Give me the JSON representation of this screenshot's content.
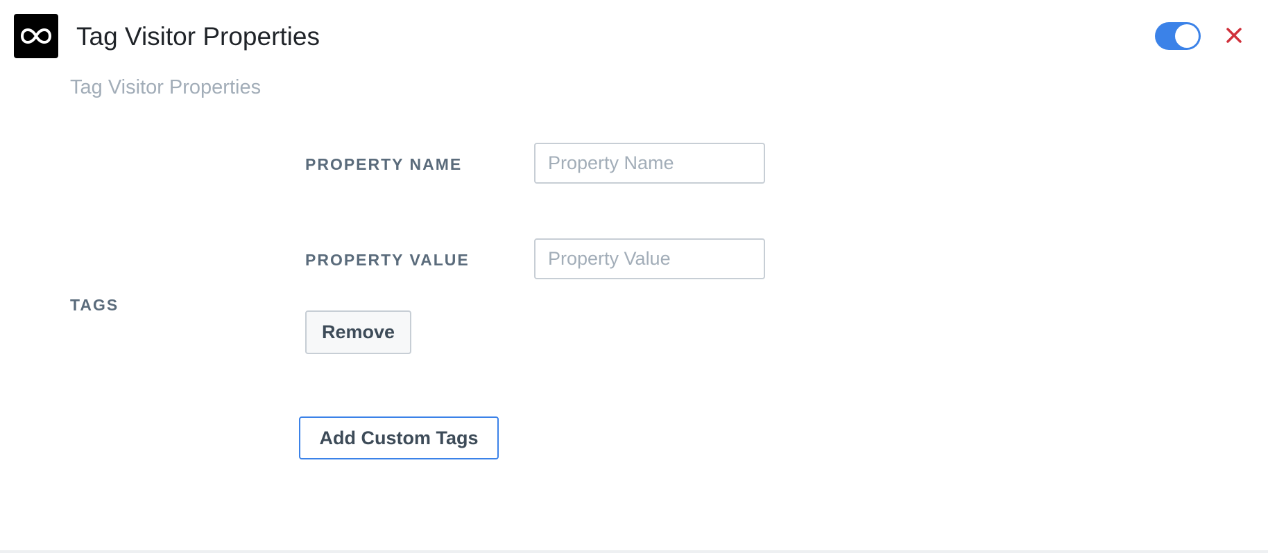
{
  "header": {
    "title": "Tag Visitor Properties",
    "subtitle": "Tag Visitor Properties",
    "logo_icon": "infinity-icon",
    "toggle_state": "on",
    "close_icon": "close-icon"
  },
  "tags": {
    "section_label": "TAGS",
    "fields": {
      "property_name_label": "PROPERTY NAME",
      "property_name_placeholder": "Property Name",
      "property_name_value": "",
      "property_value_label": "PROPERTY VALUE",
      "property_value_placeholder": "Property Value",
      "property_value_value": ""
    },
    "remove_label": "Remove",
    "add_label": "Add Custom Tags"
  },
  "colors": {
    "accent": "#3b82e8",
    "close": "#d0303a",
    "label": "#5a6b7b",
    "muted": "#a2adb8"
  }
}
